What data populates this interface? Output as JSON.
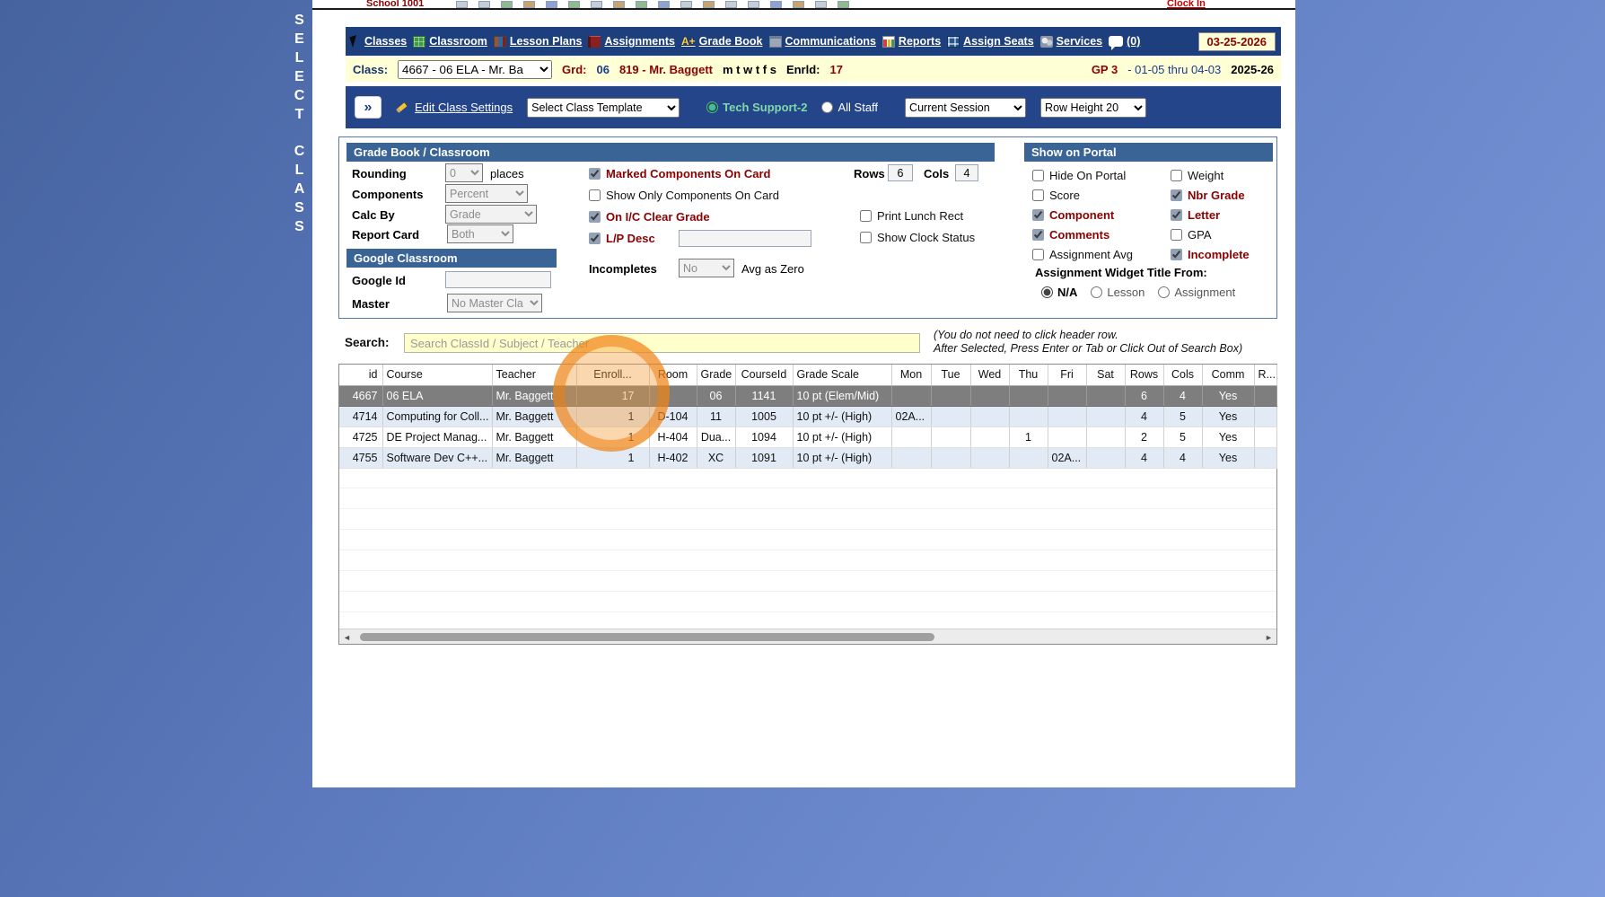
{
  "side": {
    "select": "SELECT",
    "class": "CLASS"
  },
  "topbar": {
    "school": "School 1001",
    "clock_in": "Clock In"
  },
  "nav": {
    "date": "03-25-2026",
    "items": [
      {
        "label": "Classes",
        "icon": "classes"
      },
      {
        "label": "Classroom",
        "icon": "classroom"
      },
      {
        "label": "Lesson Plans",
        "icon": "lesson-plans"
      },
      {
        "label": "Assignments",
        "icon": "assignments"
      },
      {
        "label": "Grade Book",
        "icon": "grade-book",
        "glyph": "A+"
      },
      {
        "label": "Communications",
        "icon": "communications"
      },
      {
        "label": "Reports",
        "icon": "reports"
      },
      {
        "label": "Assign Seats",
        "icon": "assign-seats"
      },
      {
        "label": "Services",
        "icon": "services"
      },
      {
        "label": "(0)",
        "icon": "chat"
      }
    ]
  },
  "class_bar": {
    "label": "Class:",
    "selected_class": "4667 - 06 ELA - Mr. Ba",
    "grd_label": "Grd:",
    "grd_value": "06",
    "teacher": "819 - Mr. Baggett",
    "days": "m t w t f s",
    "enrld_label": "Enrld:",
    "enrld_value": "17",
    "gp": "GP 3",
    "date_range": "- 01-05 thru 04-03",
    "year": "2025-26"
  },
  "toolbar": {
    "expand_glyph": "»",
    "edit_class_settings": "Edit Class Settings",
    "class_template": "Select Class Template",
    "tech_support": "Tech Support-2",
    "all_staff": "All Staff",
    "session": "Current Session",
    "row_height": "Row Height 20"
  },
  "settings": {
    "header": "Grade Book / Classroom",
    "rounding_label": "Rounding",
    "rounding_value": "0",
    "rounding_suffix": "places",
    "components_label": "Components",
    "components_value": "Percent",
    "calc_by_label": "Calc By",
    "calc_by_value": "Grade",
    "report_card_label": "Report Card",
    "report_card_value": "Both",
    "google_header": "Google Classroom",
    "google_id_label": "Google Id",
    "google_id_value": "",
    "master_label": "Master",
    "master_value": "No Master Cla",
    "checkboxes": [
      {
        "label": "Marked Components On Card",
        "checked": true
      },
      {
        "label": "Show Only Components On Card",
        "checked": false
      },
      {
        "label": "On I/C Clear Grade",
        "checked": true
      },
      {
        "label": "L/P Desc",
        "checked": true
      }
    ],
    "lp_desc_value": "",
    "incompletes_label": "Incompletes",
    "incompletes_value": "No",
    "incompletes_suffix": "Avg as Zero",
    "rows_label": "Rows",
    "rows_value": "6",
    "cols_label": "Cols",
    "cols_value": "4",
    "print_lunch": {
      "label": "Print Lunch Rect",
      "checked": false
    },
    "show_clock": {
      "label": "Show Clock Status",
      "checked": false
    }
  },
  "portal": {
    "header": "Show on Portal",
    "col1": [
      {
        "label": "Hide On Portal",
        "checked": false
      },
      {
        "label": "Score",
        "checked": false
      },
      {
        "label": "Component",
        "checked": true
      },
      {
        "label": "Comments",
        "checked": true
      },
      {
        "label": "Assignment Avg",
        "checked": false
      }
    ],
    "col2": [
      {
        "label": "Weight",
        "checked": false
      },
      {
        "label": "Nbr Grade",
        "checked": true
      },
      {
        "label": "Letter",
        "checked": true
      },
      {
        "label": "GPA",
        "checked": false
      },
      {
        "label": "Incomplete",
        "checked": true
      }
    ],
    "widget_title": "Assignment Widget Title From:",
    "options": [
      {
        "label": "N/A",
        "selected": true
      },
      {
        "label": "Lesson",
        "selected": false
      },
      {
        "label": "Assignment",
        "selected": false
      }
    ]
  },
  "search": {
    "label": "Search:",
    "placeholder": "Search ClassId / Subject / Teacher",
    "hint_line1": "(You do not need to click header row.",
    "hint_line2": "After Selected, Press Enter or Tab or Click Out of Search Box)"
  },
  "table": {
    "columns": [
      "id",
      "Course",
      "Teacher",
      "Enroll...",
      "Room",
      "Grade",
      "CourseId",
      "Grade Scale",
      "Mon",
      "Tue",
      "Wed",
      "Thu",
      "Fri",
      "Sat",
      "Rows",
      "Cols",
      "Comm",
      "R..."
    ],
    "rows": [
      {
        "id": "4667",
        "course": "06 ELA",
        "teacher": "Mr. Baggett",
        "enroll": "17",
        "room": "",
        "grade": "06",
        "courseid": "1141",
        "grade_scale": "10 pt (Elem/Mid)",
        "mon": "",
        "tue": "",
        "wed": "",
        "thu": "",
        "fri": "",
        "sat": "",
        "rows": "6",
        "cols": "4",
        "comm": "Yes",
        "r": "",
        "selected": true
      },
      {
        "id": "4714",
        "course": "Computing for Coll...",
        "teacher": "Mr. Baggett",
        "enroll": "1",
        "room": "D-104",
        "grade": "11",
        "courseid": "1005",
        "grade_scale": "10 pt +/- (High)",
        "mon": "02A...",
        "tue": "",
        "wed": "",
        "thu": "",
        "fri": "",
        "sat": "",
        "rows": "4",
        "cols": "5",
        "comm": "Yes",
        "r": "",
        "selected": false
      },
      {
        "id": "4725",
        "course": "DE Project Manag...",
        "teacher": "Mr. Baggett",
        "enroll": "1",
        "room": "H-404",
        "grade": "Dua...",
        "courseid": "1094",
        "grade_scale": "10 pt +/- (High)",
        "mon": "",
        "tue": "",
        "wed": "",
        "thu": "1",
        "fri": "",
        "sat": "",
        "rows": "2",
        "cols": "5",
        "comm": "Yes",
        "r": "",
        "selected": false
      },
      {
        "id": "4755",
        "course": "Software Dev C++...",
        "teacher": "Mr. Baggett",
        "enroll": "1",
        "room": "H-402",
        "grade": "XC",
        "courseid": "1091",
        "grade_scale": "10 pt +/- (High)",
        "mon": "",
        "tue": "",
        "wed": "",
        "thu": "",
        "fri": "02A...",
        "sat": "",
        "rows": "4",
        "cols": "4",
        "comm": "Yes",
        "r": "",
        "selected": false
      }
    ]
  },
  "scrollbar": {
    "left_glyph": "◄",
    "right_glyph": "►"
  },
  "annotation": {
    "highlight_color": "#ee7e10"
  }
}
